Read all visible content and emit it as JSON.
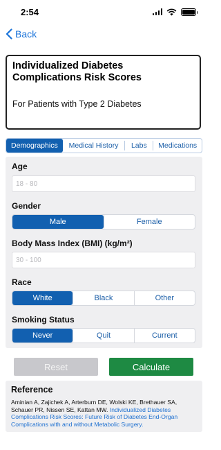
{
  "status": {
    "time": "2:54"
  },
  "nav": {
    "back_label": "Back"
  },
  "header": {
    "title": "Individualized Diabetes Complications Risk Scores",
    "subtitle": "For Patients with Type 2 Diabetes"
  },
  "tabs": [
    {
      "label": "Demographics",
      "active": true
    },
    {
      "label": "Medical History",
      "active": false
    },
    {
      "label": "Labs",
      "active": false
    },
    {
      "label": "Medications",
      "active": false
    }
  ],
  "form": {
    "age": {
      "label": "Age",
      "placeholder": "18 - 80",
      "value": ""
    },
    "gender": {
      "label": "Gender",
      "options": [
        "Male",
        "Female"
      ],
      "selected": "Male"
    },
    "bmi": {
      "label": "Body Mass Index (BMI) (kg/m²)",
      "placeholder": "30 - 100",
      "value": ""
    },
    "race": {
      "label": "Race",
      "options": [
        "White",
        "Black",
        "Other"
      ],
      "selected": "White"
    },
    "smoking": {
      "label": "Smoking Status",
      "options": [
        "Never",
        "Quit",
        "Current"
      ],
      "selected": "Never"
    }
  },
  "actions": {
    "reset_label": "Reset",
    "calculate_label": "Calculate"
  },
  "reference": {
    "title": "Reference",
    "authors": "Aminian A, Zajichek A, Arterburn DE, Wolski KE, Brethauer SA, Schauer PR, Nissen SE, Kattan MW. ",
    "link_text": "Individualized Diabetes Complications Risk Scores: Future Risk of Diabetes End-Organ Complications with and without Metabolic Surgery."
  },
  "colors": {
    "accent": "#1260b0",
    "link": "#1a73d9",
    "calculate": "#1e8a43",
    "reset_disabled": "#c8c8cc",
    "panel_bg": "#efeff1"
  },
  "icons": [
    "back-chevron-icon",
    "signal-icon",
    "wifi-icon",
    "battery-icon"
  ]
}
